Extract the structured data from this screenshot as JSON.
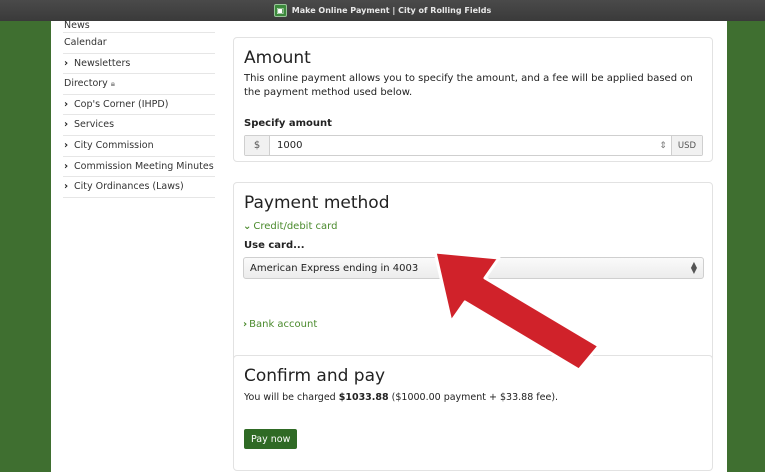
{
  "window": {
    "title": "Make Online Payment | City of Rolling Fields",
    "favicon_icon": "site-favicon-icon"
  },
  "colors": {
    "brand_green": "#3f6f30",
    "link_green": "#4a8a2c",
    "button_green": "#2f6a25",
    "annotation_red": "#d0222a"
  },
  "sidebar": {
    "items": [
      {
        "label": "News",
        "has_chevron": false
      },
      {
        "label": "Calendar",
        "has_chevron": false
      },
      {
        "label": "Newsletters",
        "has_chevron": true
      },
      {
        "label": "Directory",
        "has_chevron": false,
        "icon": "lock-icon"
      },
      {
        "label": "Cop's Corner (IHPD)",
        "has_chevron": true
      },
      {
        "label": "Services",
        "has_chevron": true
      },
      {
        "label": "City Commission",
        "has_chevron": true
      },
      {
        "label": "Commission Meeting Minutes",
        "has_chevron": true
      },
      {
        "label": "City Ordinances (Laws)",
        "has_chevron": true
      }
    ]
  },
  "amount": {
    "heading": "Amount",
    "description": "This online payment allows you to specify the amount, and a fee will be applied based on the payment method used below.",
    "specify_label": "Specify amount",
    "currency_symbol": "$",
    "value": "1000",
    "currency_code": "USD"
  },
  "payment_method": {
    "heading": "Payment method",
    "card_toggle_label": "Credit/debit card",
    "use_card_label": "Use card...",
    "selected_card": "American Express ending in 4003",
    "bank_toggle_label": "Bank account"
  },
  "confirm": {
    "heading": "Confirm and pay",
    "text_prefix": "You will be charged ",
    "total": "$1033.88",
    "text_suffix": " ($1000.00 payment + $33.88 fee).",
    "pay_button": "Pay now"
  },
  "annotation": {
    "icon": "red-arrow-icon"
  }
}
